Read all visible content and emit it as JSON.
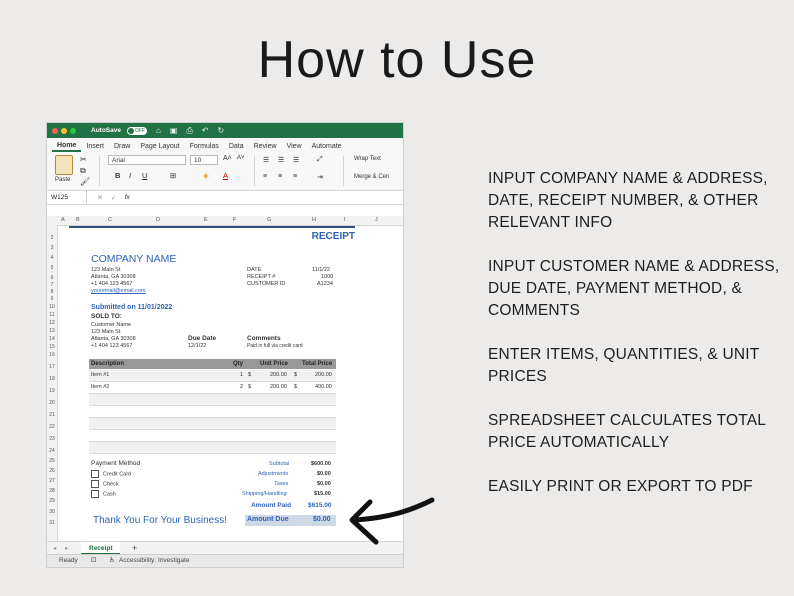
{
  "title": "How to Use",
  "excel": {
    "titlebar": {
      "autosave_label": "AutoSave",
      "autosave_state": "OFF"
    },
    "menu_tabs": [
      "Home",
      "Insert",
      "Draw",
      "Page Layout",
      "Formulas",
      "Data",
      "Review",
      "View",
      "Automate"
    ],
    "ribbon": {
      "paste_label": "Paste",
      "font_name": "Arial",
      "font_size": "10",
      "wrap_text_label": "Wrap Text",
      "merge_label": "Merge & Cen"
    },
    "formula_bar": {
      "name_box": "W125",
      "fx_label": "fx"
    },
    "columns": [
      "A",
      "B",
      "C",
      "D",
      "E",
      "F",
      "G",
      "H",
      "I",
      "J"
    ],
    "rows": [
      "2",
      "3",
      "4",
      "5",
      "6",
      "7",
      "8",
      "9",
      "10",
      "11",
      "12",
      "13",
      "14",
      "15",
      "16",
      "17",
      "18",
      "19",
      "20",
      "21",
      "22",
      "23",
      "24",
      "25",
      "26",
      "27",
      "28",
      "29",
      "30",
      "31"
    ],
    "receipt": {
      "heading": "RECEIPT",
      "company_name": "COMPANY NAME",
      "company_address_1": "123 Main St",
      "company_address_2": "Atlanta, GA 30308",
      "company_phone": "+1 404 123 4567",
      "company_email": "youremail@email.com",
      "date_label": "DATE",
      "date_value": "11/1/22",
      "receipt_no_label": "RECEIPT #",
      "receipt_no_value": "1000",
      "customer_id_label": "CUSTOMER ID",
      "customer_id_value": "A1234",
      "submitted": "Submitted on 11/01/2022",
      "sold_to_label": "SOLD TO:",
      "customer_name": "Customer Name",
      "customer_address_1": "123 Main St",
      "customer_address_2": "Atlanta, GA 30308",
      "customer_phone": "+1 404 123 4567",
      "due_date_label": "Due Date",
      "due_date_value": "12/1/22",
      "comments_label": "Comments",
      "comments_value": "Paid in full via credit card",
      "table_headers": {
        "description": "Description",
        "qty": "Qty",
        "unit_price": "Unit Price",
        "total_price": "Total Price"
      },
      "items": [
        {
          "description": "Item #1",
          "qty": "1",
          "unit_price": "200.00",
          "total_price": "200.00",
          "currency": "$"
        },
        {
          "description": "Item #2",
          "qty": "2",
          "unit_price": "200.00",
          "total_price": "400.00",
          "currency": "$"
        }
      ],
      "payment_method_label": "Payment Method",
      "payment_options": [
        "Credit Card",
        "Check",
        "Cash"
      ],
      "subtotal_label": "Subtotal",
      "subtotal_value": "$600.00",
      "adjustments_label": "Adjustments",
      "adjustments_value": "$0.00",
      "taxes_label": "Taxes",
      "taxes_value": "$0.00",
      "shipping_label": "Shipping/Handling",
      "shipping_value": "$15.00",
      "amount_paid_label": "Amount Paid",
      "amount_paid_value": "$615.00",
      "thanks": "Thank You For Your Business!",
      "amount_due_label": "Amount Due",
      "amount_due_value": "$0.00"
    },
    "sheet_tab": "Receipt",
    "add_sheet": "+",
    "status": {
      "ready": "Ready",
      "accessibility": "Accessibility: Investigate"
    }
  },
  "steps": [
    "INPUT COMPANY NAME & ADDRESS, DATE, RECEIPT NUMBER, & OTHER RELEVANT INFO",
    "INPUT CUSTOMER NAME & ADDRESS, DUE DATE, PAYMENT METHOD, & COMMENTS",
    "ENTER ITEMS, QUANTITIES, & UNIT PRICES",
    "SPREADSHEET CALCULATES TOTAL PRICE AUTOMATICALLY",
    "EASILY PRINT OR EXPORT TO PDF"
  ],
  "colors": {
    "excel_green": "#217346",
    "receipt_blue": "#2e63b8",
    "background": "#ecebea"
  }
}
